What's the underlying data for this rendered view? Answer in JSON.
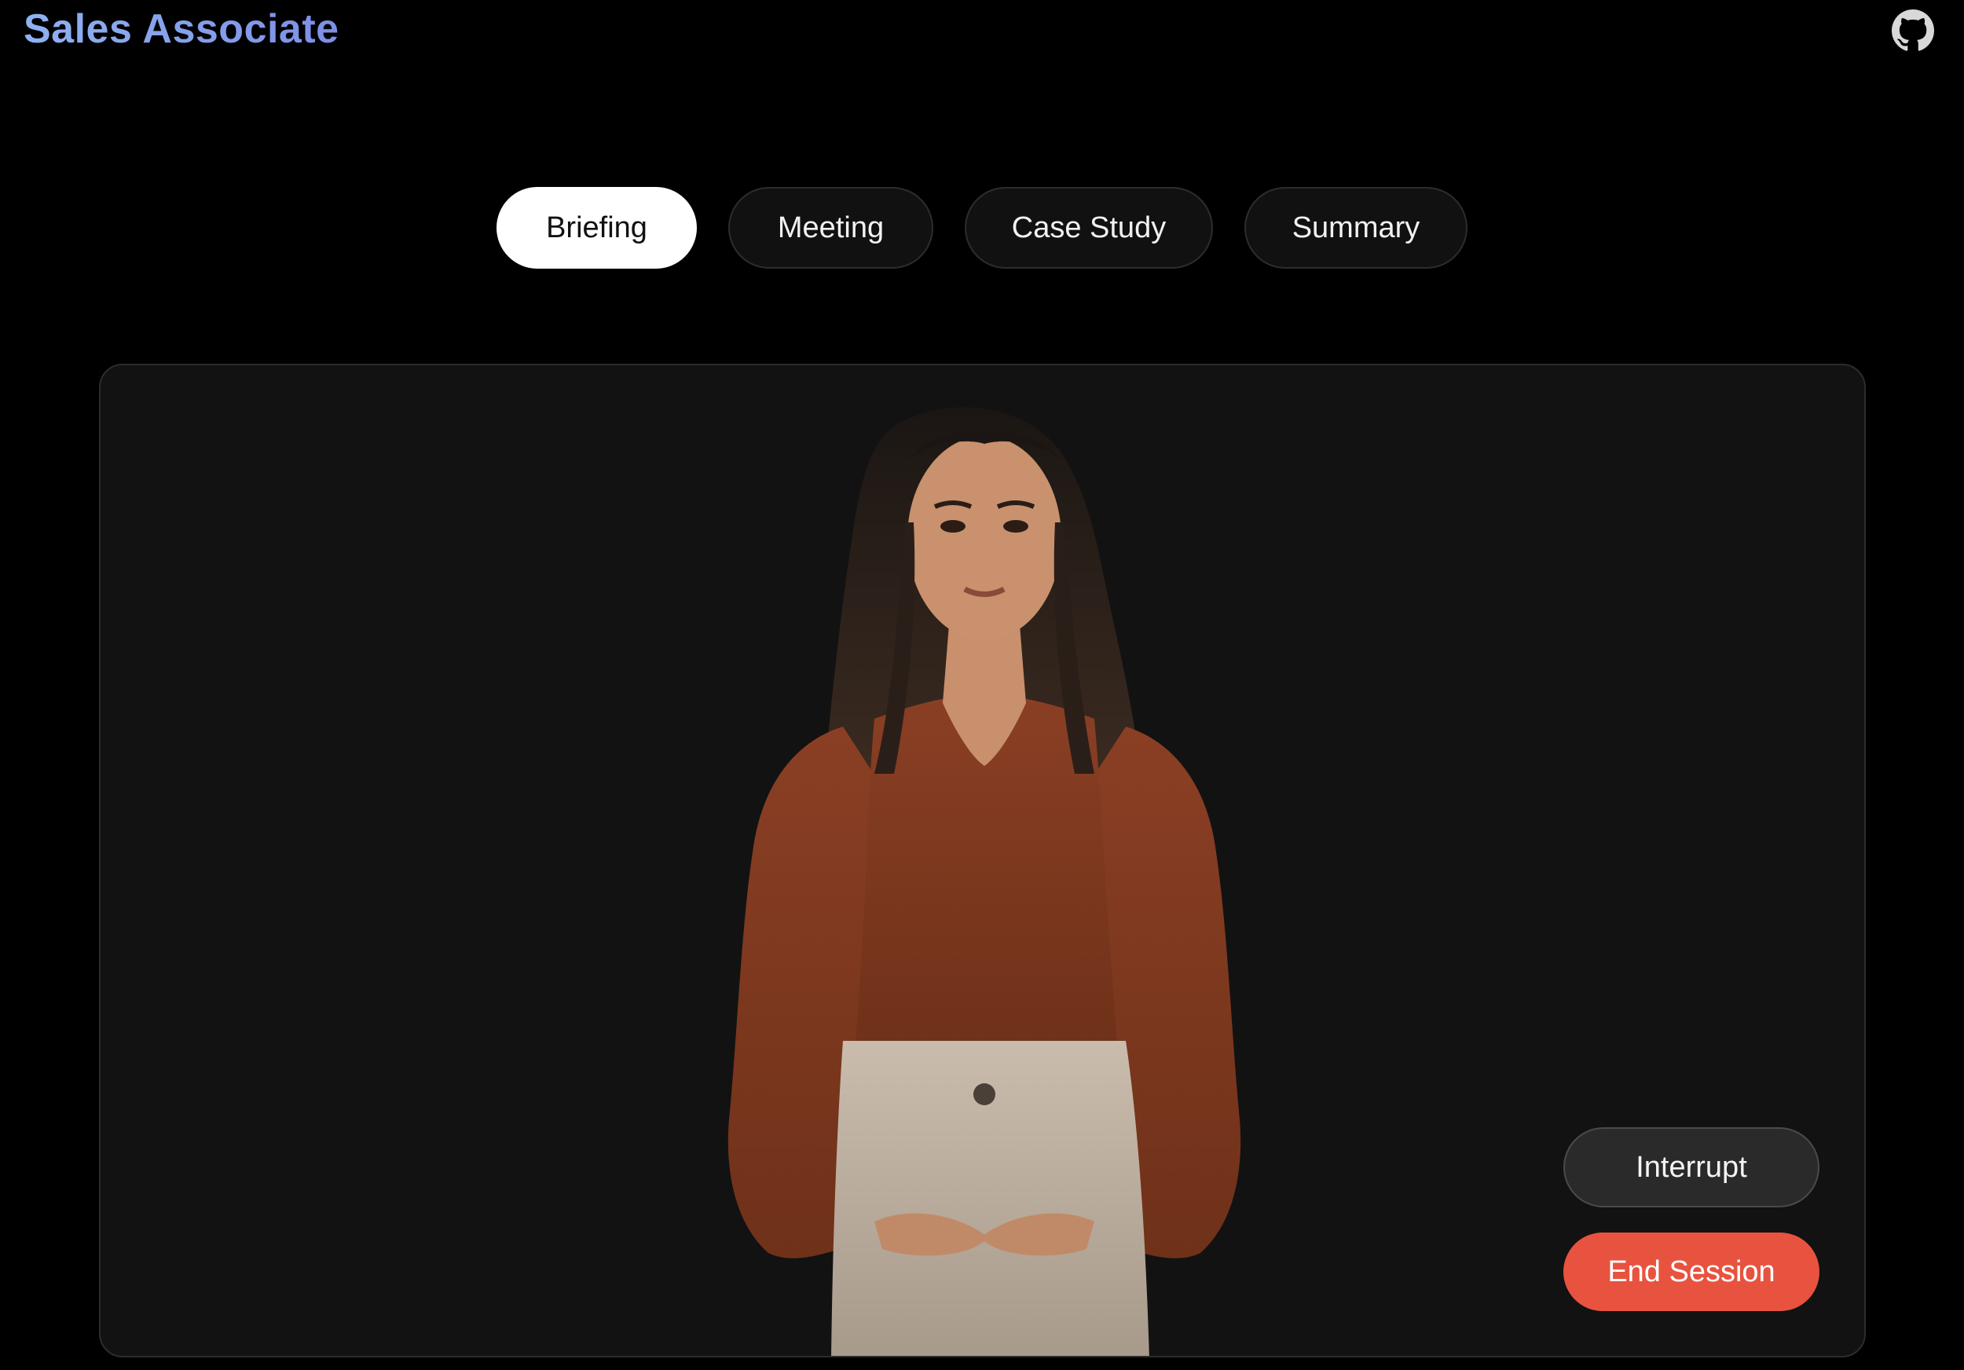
{
  "header": {
    "title": "Sales Associate",
    "github_icon": "github-icon"
  },
  "tabs": [
    {
      "label": "Briefing",
      "active": true
    },
    {
      "label": "Meeting",
      "active": false
    },
    {
      "label": "Case Study",
      "active": false
    },
    {
      "label": "Summary",
      "active": false
    }
  ],
  "video": {
    "avatar": "presenter-avatar",
    "controls": {
      "interrupt_label": "Interrupt",
      "end_session_label": "End Session"
    }
  },
  "colors": {
    "background": "#000000",
    "panel": "#121212",
    "title_gradient_start": "#8fb2f2",
    "title_gradient_end": "#7d8fe6",
    "end_session": "#e8533f",
    "active_tab": "#ffffff"
  }
}
